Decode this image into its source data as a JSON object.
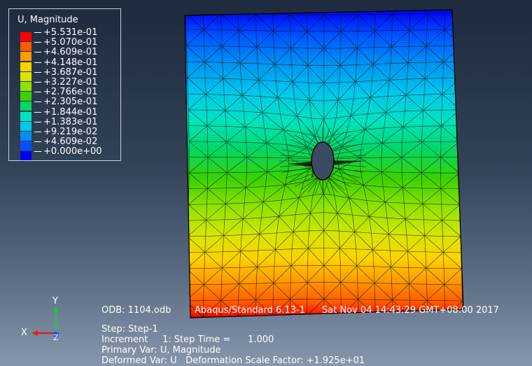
{
  "legend": {
    "title": "U, Magnitude",
    "values": [
      "+5.531e-01",
      "+5.070e-01",
      "+4.609e-01",
      "+4.148e-01",
      "+3.687e-01",
      "+3.227e-01",
      "+2.766e-01",
      "+2.305e-01",
      "+1.844e-01",
      "+1.383e-01",
      "+9.219e-02",
      "+4.609e-02",
      "+0.000e+00"
    ],
    "colors": [
      "#ff0000",
      "#ff5a00",
      "#ff9a00",
      "#ffd200",
      "#d6e600",
      "#8fe300",
      "#3cd100",
      "#00d76a",
      "#00e3c0",
      "#00c8ec",
      "#0090f2",
      "#0050ff",
      "#0000f0"
    ]
  },
  "info": {
    "odb": "ODB: 1104.odb",
    "solver": "Abaqus/Standard 6.13-1",
    "datetime": "Sat Nov 04 14:43:29 GMT+08:00 2017",
    "step": "Step: Step-1",
    "increment": "Increment     1: Step Time =      1.000",
    "primary_var": "Primary Var: U, Magnitude",
    "deformed_var": "Deformed Var: U   Deformation Scale Factor: +1.925e+01"
  },
  "triad": {
    "x_label": "X",
    "y_label": "Y",
    "z_label": "Z"
  }
}
